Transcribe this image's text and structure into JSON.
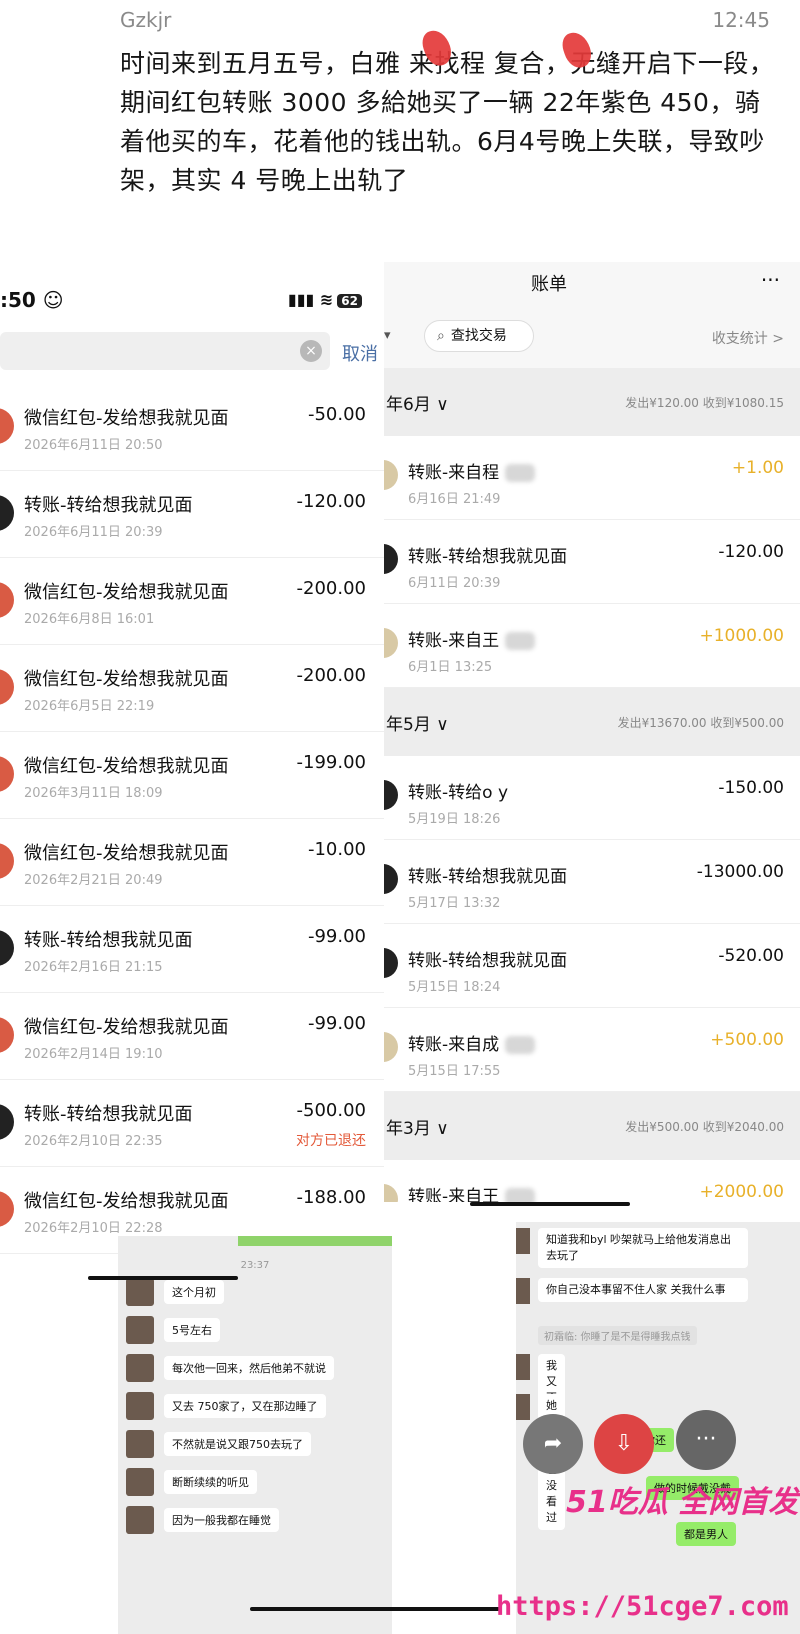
{
  "post": {
    "author": "Gzkjr",
    "time": "12:45",
    "body": "时间来到五月五号，白雅 来找程 复合，无缝开启下一段，期间红包转账 3000 多給她买了一辆 22年紫色 450，骑着他买的车，花着他的钱出轨。6月4号晚上失联，导致吵架，其实 4 号晚上出轨了"
  },
  "left_screen": {
    "clock": ":50 ☺",
    "signal": "▮▮▮ ≋",
    "battery": "62",
    "cancel": "取消",
    "items": [
      {
        "title": "微信红包-发给想我就见面",
        "date": "2026年6月11日 20:50",
        "amount": "-50.00",
        "note": "",
        "avatar": "red"
      },
      {
        "title": "转账-转给想我就见面",
        "date": "2026年6月11日 20:39",
        "amount": "-120.00",
        "note": "",
        "avatar": "dark"
      },
      {
        "title": "微信红包-发给想我就见面",
        "date": "2026年6月8日 16:01",
        "amount": "-200.00",
        "note": "",
        "avatar": "red"
      },
      {
        "title": "微信红包-发给想我就见面",
        "date": "2026年6月5日 22:19",
        "amount": "-200.00",
        "note": "",
        "avatar": "red"
      },
      {
        "title": "微信红包-发给想我就见面",
        "date": "2026年3月11日 18:09",
        "amount": "-199.00",
        "note": "",
        "avatar": "red"
      },
      {
        "title": "微信红包-发给想我就见面",
        "date": "2026年2月21日 20:49",
        "amount": "-10.00",
        "note": "",
        "avatar": "red"
      },
      {
        "title": "转账-转给想我就见面",
        "date": "2026年2月16日 21:15",
        "amount": "-99.00",
        "note": "",
        "avatar": "dark"
      },
      {
        "title": "微信红包-发给想我就见面",
        "date": "2026年2月14日 19:10",
        "amount": "-99.00",
        "note": "",
        "avatar": "red"
      },
      {
        "title": "转账-转给想我就见面",
        "date": "2026年2月10日 22:35",
        "amount": "-500.00",
        "note": "对方已退还",
        "avatar": "dark"
      },
      {
        "title": "微信红包-发给想我就见面",
        "date": "2026年2月10日 22:28",
        "amount": "-188.00",
        "note": "",
        "avatar": "red"
      }
    ]
  },
  "right_screen": {
    "title": "账单",
    "more": "···",
    "filter": "▾",
    "search": "查找交易",
    "stats": "收支统计 >",
    "groups": [
      {
        "month": "年6月 ∨",
        "summary": "发出¥120.00  收到¥1080.15",
        "items": [
          {
            "title": "转账-来自程",
            "date": "6月16日 21:49",
            "amount": "+1.00",
            "positive": true
          },
          {
            "title": "转账-转给想我就见面",
            "date": "6月11日 20:39",
            "amount": "-120.00",
            "positive": false
          },
          {
            "title": "转账-来自王",
            "date": "6月1日 13:25",
            "amount": "+1000.00",
            "positive": true
          }
        ]
      },
      {
        "month": "年5月 ∨",
        "summary": "发出¥13670.00  收到¥500.00",
        "items": [
          {
            "title": "转账-转给o y",
            "date": "5月19日 18:26",
            "amount": "-150.00",
            "positive": false
          },
          {
            "title": "转账-转给想我就见面",
            "date": "5月17日 13:32",
            "amount": "-13000.00",
            "positive": false
          },
          {
            "title": "转账-转给想我就见面",
            "date": "5月15日 18:24",
            "amount": "-520.00",
            "positive": false
          },
          {
            "title": "转账-来自成",
            "date": "5月15日 17:55",
            "amount": "+500.00",
            "positive": true
          }
        ]
      },
      {
        "month": "年3月 ∨",
        "summary": "发出¥500.00  收到¥2040.00",
        "items": [
          {
            "title": "转账-来自王",
            "date": "",
            "amount": "+2000.00",
            "positive": true
          }
        ]
      }
    ]
  },
  "chat_left": {
    "timestamp": "23:37",
    "messages": [
      "这个月初",
      "5号左右",
      "每次他一回来，然后他弟不就说",
      "又去 750家了，又在那边睡了",
      "不然就是说又跟750去玩了",
      "断断续续的听见",
      "因为一般我都在睡觉"
    ]
  },
  "chat_right": {
    "messages": [
      "知道我和byl 吵架就马上给他发消息出去玩了",
      "你自己没本事留不住人家 关我什么事",
      "我又不知道",
      "她手机我也没看过"
    ],
    "system": "初霜临: 你睡了是不是得睡我点钱",
    "green_messages": [
      "你还",
      "做的时候戴没戴",
      "都是男人"
    ]
  },
  "overlay": {
    "brand": "51吃瓜 全网首发",
    "url": "https://51cge7.com",
    "share_icon": "share-icon",
    "download_icon": "download-icon",
    "more_icon": "more-icon",
    "share_glyph": "➦",
    "download_glyph": "⇩",
    "more_glyph": "···"
  }
}
